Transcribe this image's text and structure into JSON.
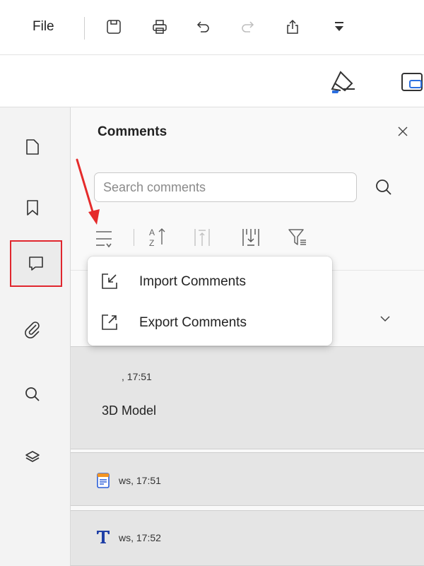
{
  "menubar": {
    "file_label": "File",
    "icons": [
      "save-icon",
      "print-icon",
      "undo-icon",
      "redo-icon",
      "share-icon",
      "more-dropdown-icon"
    ]
  },
  "toolbar2": {
    "icons": [
      "highlighter-icon",
      "shape-tool-icon"
    ]
  },
  "sidebar": {
    "items": [
      {
        "name": "pages",
        "icon": "page-icon"
      },
      {
        "name": "bookmarks",
        "icon": "bookmark-icon"
      },
      {
        "name": "comments",
        "icon": "comment-icon",
        "active": true
      },
      {
        "name": "attachments",
        "icon": "paperclip-icon"
      },
      {
        "name": "search",
        "icon": "search-icon"
      },
      {
        "name": "layers",
        "icon": "layers-icon"
      }
    ]
  },
  "comments_panel": {
    "title": "Comments",
    "search": {
      "placeholder": "Search comments",
      "value": ""
    },
    "toolbar_icons": [
      "options-menu-icon",
      "sort-icon",
      "collapse-all-icon",
      "expand-all-icon",
      "filter-icon"
    ],
    "dropdown": {
      "items": [
        {
          "label": "Import Comments",
          "icon": "import-icon"
        },
        {
          "label": "Export Comments",
          "icon": "export-icon"
        }
      ]
    },
    "cards": [
      {
        "meta": ", 17:51",
        "text": "3D Model"
      },
      {
        "meta": "ws, 17:51",
        "icon": "note-icon"
      },
      {
        "meta": "ws, 17:52",
        "icon": "text-icon"
      }
    ]
  },
  "colors": {
    "accent_red": "#e0262e",
    "annotation_arrow": "#e52b2b",
    "note_orange": "#f29422",
    "note_blue": "#2b5fd9"
  }
}
